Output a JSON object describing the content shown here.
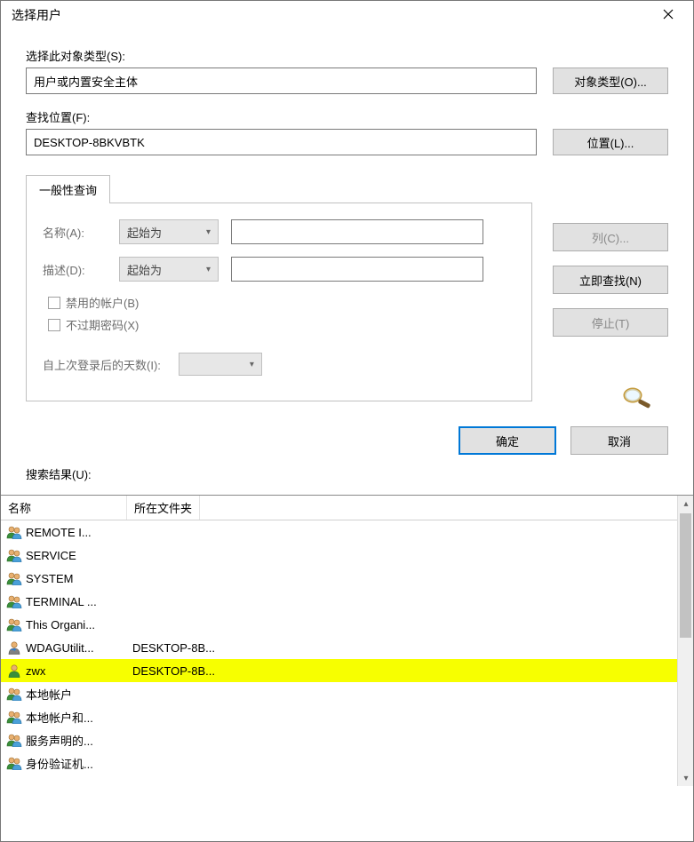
{
  "window": {
    "title": "选择用户"
  },
  "object_type": {
    "label": "选择此对象类型(S):",
    "value": "用户或内置安全主体",
    "button": "对象类型(O)..."
  },
  "location": {
    "label": "查找位置(F):",
    "value": "DESKTOP-8BKVBTK",
    "button": "位置(L)..."
  },
  "tab": {
    "label": "一般性查询"
  },
  "query": {
    "name_label": "名称(A):",
    "name_mode": "起始为",
    "name_value": "",
    "desc_label": "描述(D):",
    "desc_mode": "起始为",
    "desc_value": "",
    "cb_disabled": "禁用的帐户(B)",
    "cb_noexpire": "不过期密码(X)",
    "days_label": "自上次登录后的天数(I):"
  },
  "side_buttons": {
    "columns": "列(C)...",
    "find_now": "立即查找(N)",
    "stop": "停止(T)"
  },
  "dialog_buttons": {
    "ok": "确定",
    "cancel": "取消"
  },
  "results_label": "搜索结果(U):",
  "columns": {
    "name": "名称",
    "folder": "所在文件夹"
  },
  "highlight_index": 6,
  "rows": [
    {
      "icon": "group",
      "name": "REMOTE I...",
      "folder": ""
    },
    {
      "icon": "group",
      "name": "SERVICE",
      "folder": ""
    },
    {
      "icon": "group",
      "name": "SYSTEM",
      "folder": ""
    },
    {
      "icon": "group",
      "name": "TERMINAL ...",
      "folder": ""
    },
    {
      "icon": "group",
      "name": "This Organi...",
      "folder": ""
    },
    {
      "icon": "user-arrow",
      "name": "WDAGUtilit...",
      "folder": "DESKTOP-8B..."
    },
    {
      "icon": "user",
      "name": "zwx",
      "folder": "DESKTOP-8B..."
    },
    {
      "icon": "group",
      "name": "本地帐户",
      "folder": ""
    },
    {
      "icon": "group",
      "name": "本地帐户和...",
      "folder": ""
    },
    {
      "icon": "group",
      "name": "服务声明的...",
      "folder": ""
    },
    {
      "icon": "group",
      "name": "身份验证机...",
      "folder": ""
    }
  ]
}
